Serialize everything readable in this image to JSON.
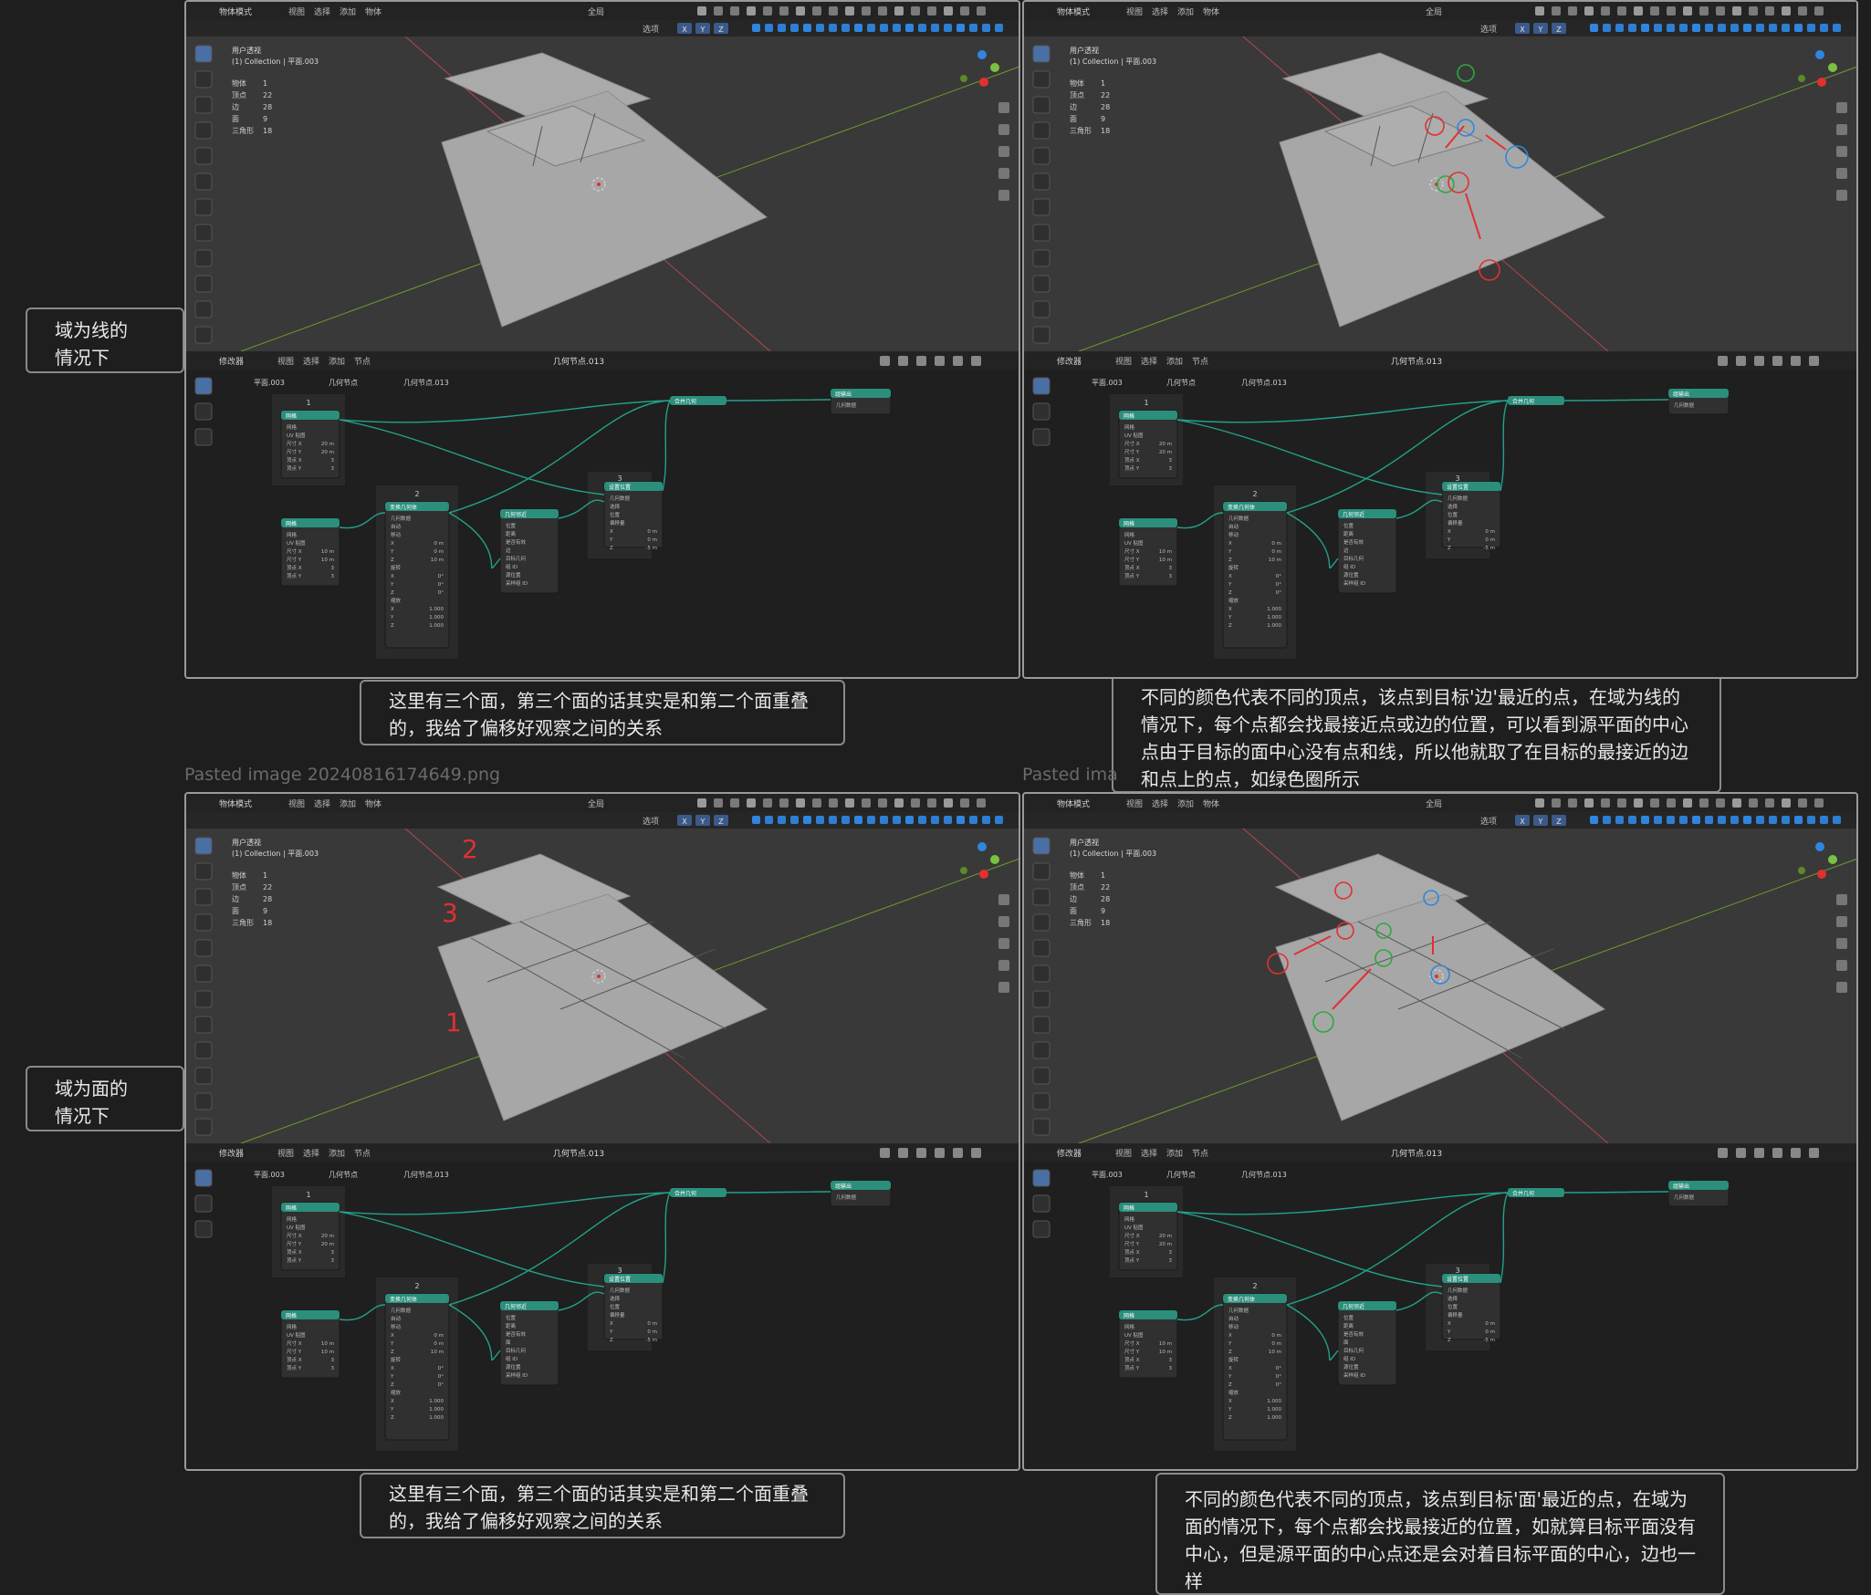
{
  "notes": {
    "domain_line": "域为线的情况下",
    "domain_line_l1": "域为线的",
    "domain_line_l2": "情况下",
    "domain_face_l1": "域为面的",
    "domain_face_l2": "情况下",
    "three_faces": "这里有三个面，第三个面的话其实是和第二个面重叠的，我给了偏移好观察之间的关系",
    "line_expl": "不同的颜色代表不同的顶点，该点到目标'边'最近的点，在域为线的情况下，每个点都会找最接近点或边的位置，可以看到源平面的中心点由于目标的面中心没有点和线，所以他就取了在目标的最接近的边和点上的点，如绿色圈所示",
    "face_expl": "不同的颜色代表不同的顶点，该点到目标'面'最近的点，在域为面的情况下，每个点都会找最接近的位置，如就算目标平面没有中心，但是源平面的中心点还是会对着目标平面的中心，边也一样"
  },
  "captions": {
    "pasted1": "Pasted image 20240816174649.png",
    "pasted2": "Pasted ima"
  },
  "viewport": {
    "mode": "物体模式",
    "menus": [
      "视图",
      "选择",
      "添加",
      "物体"
    ],
    "global": "全局",
    "options": "选项",
    "axes": [
      "X",
      "Y",
      "Z"
    ],
    "view_name": "用户透视",
    "collection": "(1) Collection | 平面.003",
    "stats_labels": [
      "物体",
      "顶点",
      "边",
      "面",
      "三角形"
    ],
    "stats_values": [
      "1",
      "22",
      "28",
      "9",
      "18"
    ]
  },
  "node_editor": {
    "editor": "修改器",
    "menus": [
      "视图",
      "选择",
      "添加",
      "节点"
    ],
    "tree": "几何节点.013",
    "breadcrumb": [
      "平面.003",
      "几何节点",
      "几何节点.013"
    ],
    "frames": [
      "1",
      "2",
      "3"
    ],
    "grid1": "网格",
    "grid2": "网格",
    "transform": "变换几何体",
    "proximity": "几何邻近",
    "set_position": "设置位置",
    "join": "合并几何",
    "output": "组输出",
    "labels": {
      "mesh": "网格",
      "uv": "UV 贴图",
      "size_x": "尺寸 X",
      "size_y": "尺寸 Y",
      "vert_x": "顶点 X",
      "vert_y": "顶点 Y",
      "geometry": "几何数据",
      "translation": "移动",
      "rotation": "旋转",
      "scale": "缩放",
      "position": "位置",
      "distance": "距离",
      "is_valid": "是否有效",
      "target": "目标几何",
      "group_id": "组 ID",
      "source_pos": "源位置",
      "sample_group": "采样组 ID",
      "selection": "选择",
      "offset": "偏移量",
      "mode": "自动"
    },
    "values": {
      "size_x": "20 m",
      "size_y": "20 m",
      "size_x2": "10 m",
      "size_y2": "10 m",
      "vert": "3",
      "tx": "0 m",
      "ty": "0 m",
      "tz": "10 m",
      "rot": "0°",
      "scale": "1.000",
      "ox": "0 m",
      "oy": "0 m",
      "oz": "-5 m"
    },
    "domain_edge": "边",
    "domain_face": "面"
  },
  "annotations": {
    "num1": "1",
    "num2": "2",
    "num3": "3"
  },
  "colors": {
    "bg": "#1e1e1e",
    "viewport": "#393939",
    "plane": "#a7a7a7",
    "node_header": "#2b8f7c",
    "wire": "#22a28a",
    "red": "#e23030",
    "green": "#2ea83c",
    "blue": "#2f86e0"
  }
}
